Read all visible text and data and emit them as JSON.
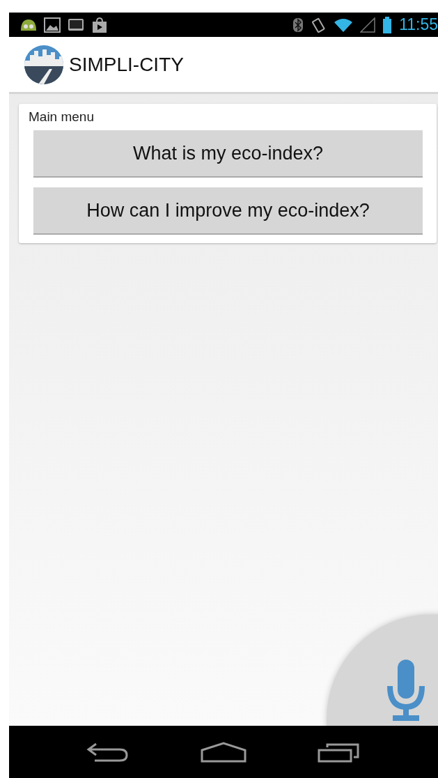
{
  "status_bar": {
    "time": "11:55"
  },
  "app_bar": {
    "title": "SIMPLI-CITY"
  },
  "menu_card": {
    "title": "Main menu",
    "buttons": [
      "What is my eco-index?",
      "How can I improve my eco-index?"
    ]
  }
}
